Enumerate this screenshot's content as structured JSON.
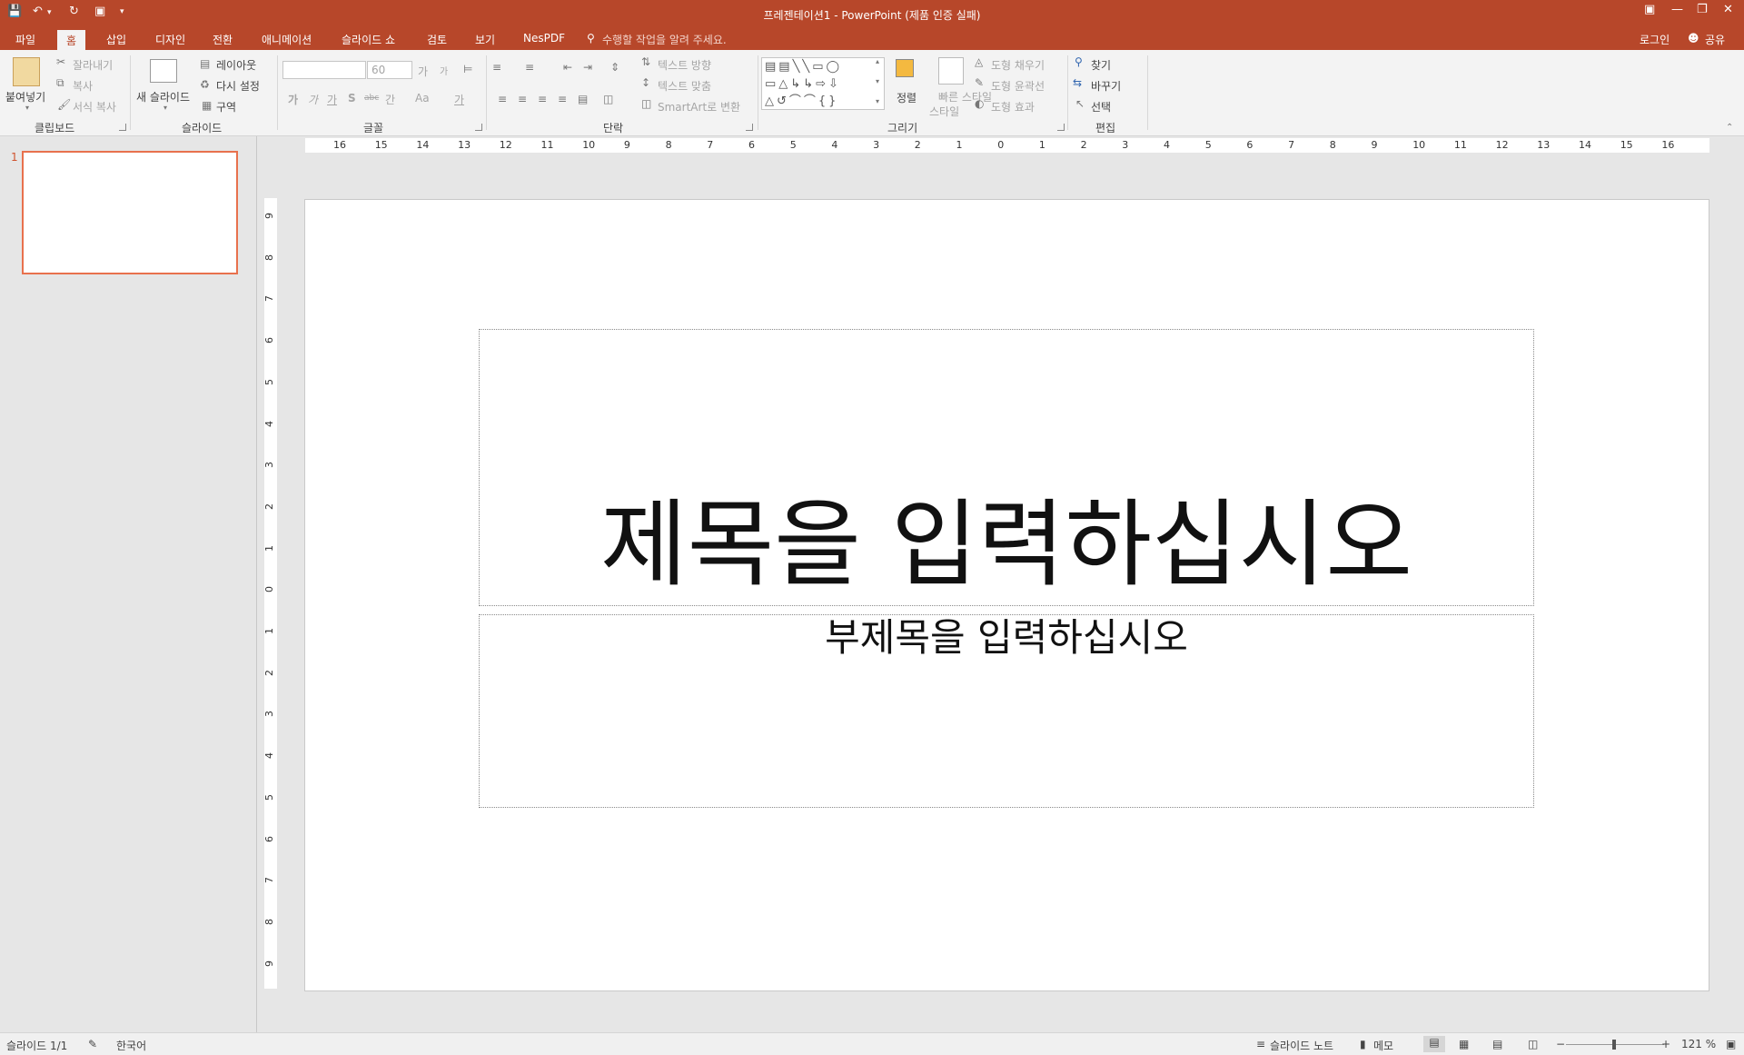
{
  "window": {
    "title": "프레젠테이션1 - PowerPoint (제품 인증 실패)",
    "accent_color": "#b7472a",
    "quick_access": [
      "save-icon",
      "undo-icon",
      "redo-icon",
      "start-presentation-icon",
      "customize-icon"
    ],
    "controls": [
      "ribbon-display-icon",
      "minimize-icon",
      "restore-icon",
      "close-icon"
    ]
  },
  "tabs": {
    "file": "파일",
    "home": "홈",
    "insert": "삽입",
    "design": "디자인",
    "transitions": "전환",
    "animations": "애니메이션",
    "slideshow": "슬라이드 쇼",
    "review": "검토",
    "view": "보기",
    "nespdf": "NesPDF",
    "tell_me": "수행할 작업을 알려 주세요.",
    "login": "로그인",
    "share": "공유"
  },
  "ribbon": {
    "clipboard": {
      "paste": "붙여넣기",
      "cut": "잘라내기",
      "copy": "복사",
      "format_painter": "서식 복사",
      "label": "클립보드"
    },
    "slides": {
      "new_slide": "새 슬라이드",
      "layout": "레이아웃",
      "reset": "다시 설정",
      "section": "구역",
      "label": "슬라이드"
    },
    "font": {
      "font_name": "",
      "font_size": "60",
      "grow": "가",
      "shrink": "가",
      "bold": "가",
      "italic": "가",
      "underline": "가",
      "shadow": "S",
      "strike": "abc",
      "spacing": "간",
      "case": "Aa",
      "color": "가",
      "label": "글꼴"
    },
    "paragraph": {
      "text_direction": "텍스트 방향",
      "align_text": "텍스트 맞춤",
      "smartart": "SmartArt로 변환",
      "label": "단락"
    },
    "drawing": {
      "arrange": "정렬",
      "quick_styles": "빠른 스타일",
      "quick_styles_2": "스타일",
      "shape_fill": "도형 채우기",
      "shape_outline": "도형 윤곽선",
      "shape_effects": "도형 효과",
      "label": "그리기"
    },
    "editing": {
      "find": "찾기",
      "replace": "바꾸기",
      "select": "선택",
      "label": "편집"
    }
  },
  "ruler": {
    "h_ticks": [
      "16",
      "15",
      "14",
      "13",
      "12",
      "11",
      "10",
      "9",
      "8",
      "7",
      "6",
      "5",
      "4",
      "3",
      "2",
      "1",
      "0",
      "1",
      "2",
      "3",
      "4",
      "5",
      "6",
      "7",
      "8",
      "9",
      "10",
      "11",
      "12",
      "13",
      "14",
      "15",
      "16"
    ],
    "v_ticks": [
      "9",
      "8",
      "7",
      "6",
      "5",
      "4",
      "3",
      "2",
      "1",
      "0",
      "1",
      "2",
      "3",
      "4",
      "5",
      "6",
      "7",
      "8",
      "9"
    ]
  },
  "thumbnails": {
    "slide_number": "1",
    "selected_color": "#e8714d"
  },
  "slide": {
    "title_placeholder": "제목을 입력하십시오",
    "subtitle_placeholder": "부제목을 입력하십시오"
  },
  "status": {
    "slide_count": "슬라이드 1/1",
    "language": "한국어",
    "notes": "슬라이드 노트",
    "comments": "메모",
    "zoom_minus": "−",
    "zoom_plus": "+",
    "zoom_level": "121 %"
  }
}
